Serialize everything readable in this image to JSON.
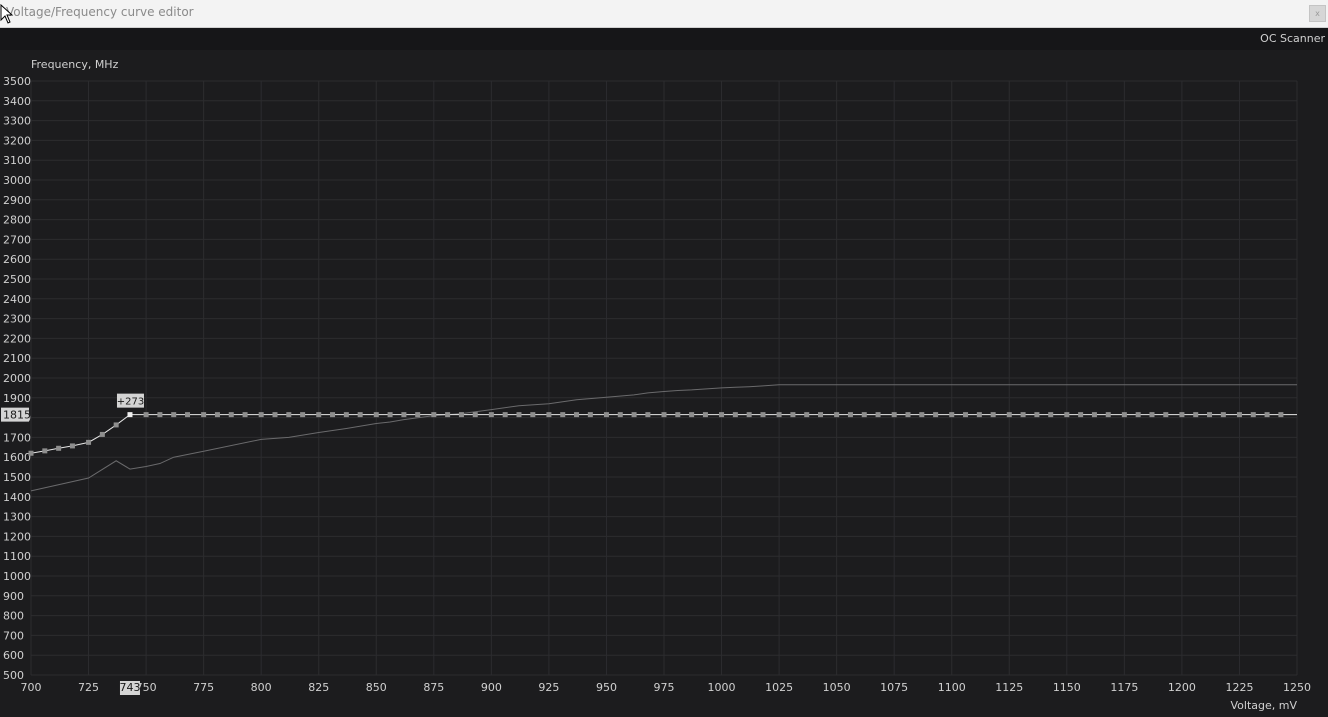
{
  "window": {
    "title": "Voltage/Frequency curve editor",
    "close_glyph": "x"
  },
  "toolbar": {
    "oc_scanner_label": "OC Scanner"
  },
  "chart_data": {
    "type": "line",
    "ylabel": "Frequency, MHz",
    "xlabel": "Voltage, mV",
    "xlim": [
      700,
      1250
    ],
    "ylim": [
      500,
      3500
    ],
    "grid": true,
    "x_ticks": [
      "700",
      "725",
      "750",
      "775",
      "800",
      "825",
      "850",
      "875",
      "900",
      "925",
      "950",
      "975",
      "1000",
      "1025",
      "1050",
      "1075",
      "1100",
      "1125",
      "1150",
      "1175",
      "1200",
      "1225",
      "1250"
    ],
    "y_ticks": [
      "500",
      "600",
      "700",
      "800",
      "900",
      "1000",
      "1100",
      "1200",
      "1300",
      "1400",
      "1500",
      "1600",
      "1700",
      "1800",
      "1900",
      "2000",
      "2100",
      "2200",
      "2300",
      "2400",
      "2500",
      "2600",
      "2700",
      "2800",
      "2900",
      "3000",
      "3100",
      "3200",
      "3300",
      "3400",
      "3500"
    ],
    "series": [
      {
        "role": "curve-points",
        "x": [
          700,
          706,
          712,
          718,
          725,
          731,
          737,
          743,
          750,
          756,
          762,
          768,
          775,
          781,
          787,
          793,
          800,
          806,
          812,
          818,
          825,
          831,
          837,
          843,
          850,
          856,
          862,
          868,
          875,
          881,
          887,
          893,
          900,
          906,
          912,
          918,
          925,
          931,
          937,
          943,
          950,
          956,
          962,
          968,
          975,
          981,
          987,
          993,
          1000,
          1006,
          1012,
          1018,
          1025,
          1031,
          1037,
          1043,
          1050,
          1056,
          1062,
          1068,
          1075,
          1081,
          1087,
          1093,
          1100,
          1106,
          1112,
          1118,
          1125,
          1131,
          1137,
          1143,
          1150,
          1156,
          1162,
          1168,
          1175,
          1181,
          1187,
          1193,
          1200,
          1206,
          1212,
          1218,
          1225,
          1231,
          1237,
          1243
        ],
        "y": [
          1620,
          1632,
          1645,
          1657,
          1675,
          1715,
          1763,
          1815,
          1815,
          1815,
          1815,
          1815,
          1815,
          1815,
          1815,
          1815,
          1815,
          1815,
          1815,
          1815,
          1815,
          1815,
          1815,
          1815,
          1815,
          1815,
          1815,
          1815,
          1815,
          1815,
          1815,
          1815,
          1815,
          1815,
          1815,
          1815,
          1815,
          1815,
          1815,
          1815,
          1815,
          1815,
          1815,
          1815,
          1815,
          1815,
          1815,
          1815,
          1815,
          1815,
          1815,
          1815,
          1815,
          1815,
          1815,
          1815,
          1815,
          1815,
          1815,
          1815,
          1815,
          1815,
          1815,
          1815,
          1815,
          1815,
          1815,
          1815,
          1815,
          1815,
          1815,
          1815,
          1815,
          1815,
          1815,
          1815,
          1815,
          1815,
          1815,
          1815,
          1815,
          1815,
          1815,
          1815,
          1815,
          1815,
          1815,
          1815
        ]
      },
      {
        "role": "curve-flat-tail",
        "x": [
          1243,
          1250
        ],
        "y": [
          1815,
          1815
        ]
      },
      {
        "role": "default-curve",
        "x": [
          700,
          725,
          737,
          743,
          750,
          756,
          762,
          775,
          800,
          812,
          825,
          831,
          837,
          850,
          856,
          862,
          875,
          881,
          887,
          900,
          912,
          925,
          931,
          937,
          950,
          962,
          968,
          975,
          981,
          987,
          1000,
          1006,
          1012,
          1018,
          1025,
          1031,
          1250
        ],
        "y": [
          1430,
          1495,
          1582,
          1540,
          1553,
          1568,
          1600,
          1630,
          1690,
          1700,
          1725,
          1735,
          1745,
          1770,
          1778,
          1790,
          1810,
          1815,
          1820,
          1840,
          1860,
          1870,
          1880,
          1890,
          1903,
          1915,
          1925,
          1932,
          1937,
          1940,
          1950,
          1953,
          1956,
          1960,
          1966,
          1966,
          1966
        ]
      }
    ],
    "selected_point": {
      "x_label": "743",
      "y_label": "1815",
      "offset_label": "+273"
    },
    "colors": {
      "background": "#1c1c1e",
      "grid": "#2c2c2f",
      "axis_text": "#d0d0d0",
      "curve": "#e6e6e6",
      "point": "#8e8e8e",
      "default_curve": "#6a6a6c",
      "highlight_bg": "#d4d4d4",
      "highlight_text": "#1a1a1a"
    }
  }
}
